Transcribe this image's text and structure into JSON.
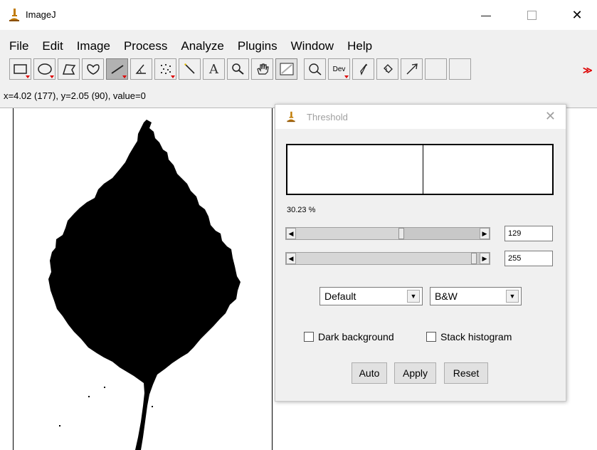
{
  "window": {
    "title": "ImageJ",
    "minimize_glyph": "—",
    "close_glyph": "✕"
  },
  "menu": [
    "File",
    "Edit",
    "Image",
    "Process",
    "Analyze",
    "Plugins",
    "Window",
    "Help"
  ],
  "toolbar": {
    "tools": [
      "rectangle-tool",
      "oval-tool",
      "polygon-tool",
      "freehand-tool",
      "line-tool",
      "angle-tool",
      "point-tool",
      "wand-tool",
      "text-tool",
      "magnifier-tool",
      "hand-tool",
      "color-picker-tool",
      "zoom-tool",
      "dev-tool",
      "brush-tool",
      "flood-fill-tool",
      "arrow-tool"
    ],
    "text_tool_label": "A",
    "dev_label": "Dev",
    "more_label": "≫"
  },
  "status": "x=4.02 (177), y=2.05 (90), value=0",
  "threshold": {
    "title": "Threshold",
    "close_glyph": "✕",
    "percent": "30.23 %",
    "min_value": "129",
    "max_value": "255",
    "method": "Default",
    "mode": "B&W",
    "dark_background_label": "Dark background",
    "stack_histogram_label": "Stack histogram",
    "auto_label": "Auto",
    "apply_label": "Apply",
    "reset_label": "Reset",
    "dark_background_checked": false,
    "stack_histogram_checked": false
  }
}
